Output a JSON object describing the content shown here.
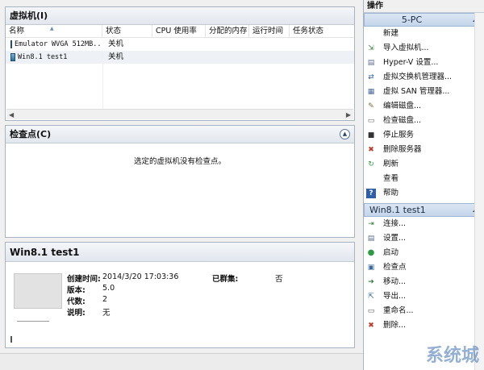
{
  "vm_panel": {
    "title": "虚拟机(I)",
    "columns": [
      "名称",
      "状态",
      "CPU 使用率",
      "分配的内存",
      "运行时间",
      "任务状态"
    ],
    "rows": [
      {
        "name": "Emulator WVGA 512MB...",
        "state": "关机"
      },
      {
        "name": "Win8.1 test1",
        "state": "关机"
      }
    ]
  },
  "checkpoint_panel": {
    "title": "检查点(C)",
    "empty_message": "选定的虚拟机没有检查点。"
  },
  "detail_panel": {
    "title": "Win8.1 test1",
    "created_label": "创建时间:",
    "created_value": "2014/3/20 17:03:36",
    "version_label": "版本:",
    "version_value": "5.0",
    "generation_label": "代数:",
    "generation_value": "2",
    "notes_label": "说明:",
    "notes_value": "无",
    "clustered_label": "已群集:",
    "clustered_value": "否"
  },
  "actions": {
    "title": "操作",
    "host_header": "5-PC",
    "host_items": [
      {
        "label": "新建",
        "icon": "none",
        "submenu": true
      },
      {
        "label": "导入虚拟机...",
        "icon": "import-icon"
      },
      {
        "label": "Hyper-V 设置...",
        "icon": "settings-icon"
      },
      {
        "label": "虚拟交换机管理器...",
        "icon": "switch-icon"
      },
      {
        "label": "虚拟 SAN 管理器...",
        "icon": "san-icon"
      },
      {
        "label": "编辑磁盘...",
        "icon": "edit-disk-icon"
      },
      {
        "label": "检查磁盘...",
        "icon": "inspect-disk-icon"
      },
      {
        "label": "停止服务",
        "icon": "stop-icon"
      },
      {
        "label": "删除服务器",
        "icon": "delete-server-icon"
      },
      {
        "label": "刷新",
        "icon": "refresh-icon"
      },
      {
        "label": "查看",
        "icon": "none",
        "submenu": true
      },
      {
        "label": "帮助",
        "icon": "help-icon"
      }
    ],
    "vm_header": "Win8.1 test1",
    "vm_items": [
      {
        "label": "连接...",
        "icon": "connect-icon"
      },
      {
        "label": "设置...",
        "icon": "vm-settings-icon"
      },
      {
        "label": "启动",
        "icon": "start-icon"
      },
      {
        "label": "检查点",
        "icon": "checkpoint-icon"
      },
      {
        "label": "移动...",
        "icon": "move-icon"
      },
      {
        "label": "导出...",
        "icon": "export-icon"
      },
      {
        "label": "重命名...",
        "icon": "rename-icon"
      },
      {
        "label": "删除...",
        "icon": "delete-icon"
      }
    ]
  },
  "watermark": "系统城",
  "colors": {
    "accent": "#3b6fb0",
    "delete": "#c0392b",
    "start": "#2e9a44"
  }
}
